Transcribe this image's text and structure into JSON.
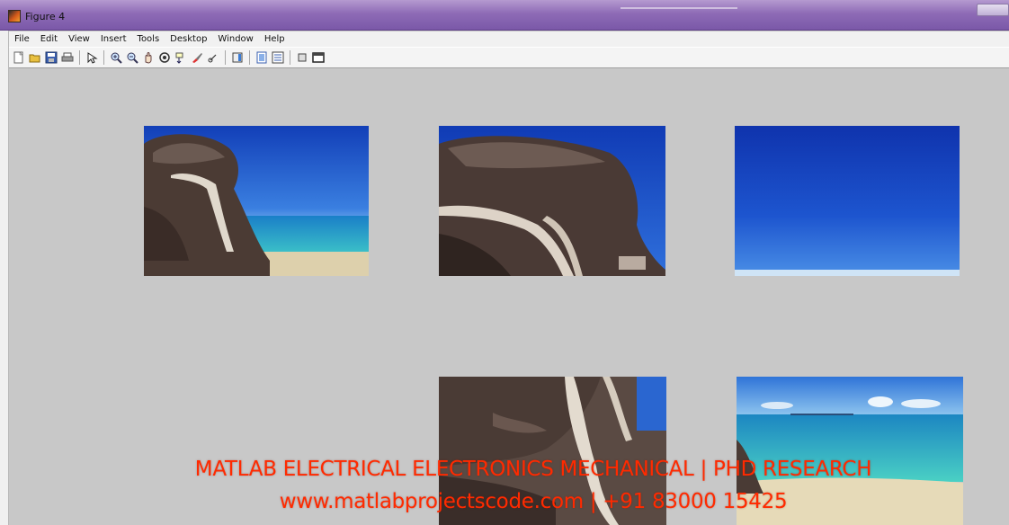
{
  "window": {
    "title": "Figure 4"
  },
  "menubar": {
    "items": [
      "File",
      "Edit",
      "View",
      "Insert",
      "Tools",
      "Desktop",
      "Window",
      "Help"
    ]
  },
  "toolbar": {
    "icons": [
      "new-figure-icon",
      "open-icon",
      "save-icon",
      "print-icon",
      "edit-plot-icon",
      "zoom-in-icon",
      "zoom-out-icon",
      "pan-icon",
      "rotate-3d-icon",
      "data-cursor-icon",
      "brush-icon",
      "link-icon",
      "colorbar-icon",
      "legend-icon",
      "hide-plot-tools-icon",
      "show-plot-tools-icon"
    ]
  },
  "figure": {
    "axes": [
      {
        "content": "rock-and-beach-photo"
      },
      {
        "content": "rock-closeup-photo"
      },
      {
        "content": "blue-sky-photo"
      },
      {
        "content": "rock-texture-photo"
      },
      {
        "content": "sea-and-beach-photo"
      }
    ]
  },
  "watermark": {
    "line1": "MATLAB ELECTRICAL ELECTRONICS MECHANICAL | PHD RESEARCH",
    "line2": "www.matlabprojectscode.com | +91 83000 15425",
    "color": "#ff2a00"
  },
  "colors": {
    "figure_background": "#c8c8c8",
    "titlebar": "#8e6bb6",
    "sky": "#1a4fc4",
    "sea": "#2aa8c0",
    "sand": "#e2d4b0",
    "rock": "#4a3a34"
  }
}
